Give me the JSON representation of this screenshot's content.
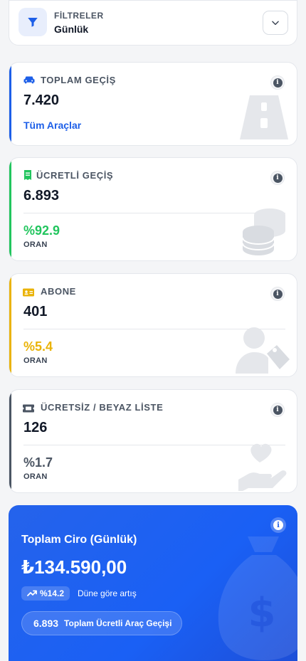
{
  "filter": {
    "label": "FİLTRELER",
    "value": "Günlük",
    "icon": "filter-icon",
    "toggle_icon": "chevron-down-icon"
  },
  "cards": {
    "toplam": {
      "label": "TOPLAM GEÇİŞ",
      "value": "7.420",
      "link": "Tüm Araçlar",
      "accent": "#1d5fe8",
      "icon": "car-icon",
      "bg_icon": "road-icon"
    },
    "ucretli": {
      "label": "ÜCRETLİ GEÇİŞ",
      "value": "6.893",
      "percent": "%92.9",
      "percent_label": "ORAN",
      "accent": "#22c55e",
      "icon": "receipt-icon",
      "bg_icon": "coins-icon"
    },
    "abone": {
      "label": "ABONE",
      "value": "401",
      "percent": "%5.4",
      "percent_label": "ORAN",
      "accent": "#eab308",
      "icon": "id-card-icon",
      "bg_icon": "user-tag-icon"
    },
    "ucretsiz": {
      "label": "ÜCRETSİZ / BEYAZ LİSTE",
      "value": "126",
      "percent": "%1.7",
      "percent_label": "ORAN",
      "accent": "#4b5563",
      "icon": "ticket-icon",
      "bg_icon": "hand-heart-icon"
    }
  },
  "revenue": {
    "title": "Toplam Ciro (Günlük)",
    "value": "₺134.590,00",
    "change": "%14.2",
    "change_caption": "Düne göre artış",
    "paid_count": "6.893",
    "paid_caption": "Toplam Ücretli Araç Geçişi",
    "accent": "#1a60f5",
    "bg_icon": "money-bag-icon"
  }
}
